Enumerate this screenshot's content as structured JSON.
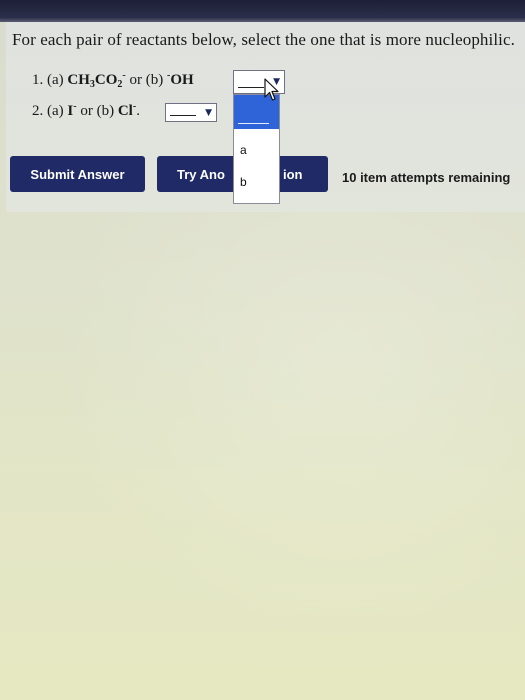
{
  "instructions": "For each pair of reactants below, select the one that is more nucleophilic.",
  "questions": [
    {
      "number": "1.",
      "a_label": "(a)",
      "a_formula_base": "CH",
      "a_sub1": "3",
      "a_formula_mid": "CO",
      "a_sub2": "2",
      "a_charge": "-",
      "or": "or",
      "b_label": "(b)",
      "b_charge_prefix": "-",
      "b_formula": "OH",
      "selected": ""
    },
    {
      "number": "2.",
      "a_label": "(a)",
      "a_formula": "I",
      "a_charge": "-",
      "or": "or",
      "b_label": "(b)",
      "b_formula": "Cl",
      "b_charge": "-",
      "end": ".",
      "selected": ""
    }
  ],
  "dropdown": {
    "options": [
      "",
      "a",
      "b"
    ],
    "highlighted_index": 0
  },
  "buttons": {
    "submit": "Submit Answer",
    "try_another_left": "Try Ano",
    "try_another_right": "ion"
  },
  "attempts_text": "10 item attempts remaining",
  "icons": {
    "select_arrow": "chevron-down-icon",
    "cursor": "mouse-pointer-icon"
  },
  "colors": {
    "button_bg": "#1f2a66",
    "highlight": "#2f63d8",
    "top_bar": "#1c1f36"
  }
}
